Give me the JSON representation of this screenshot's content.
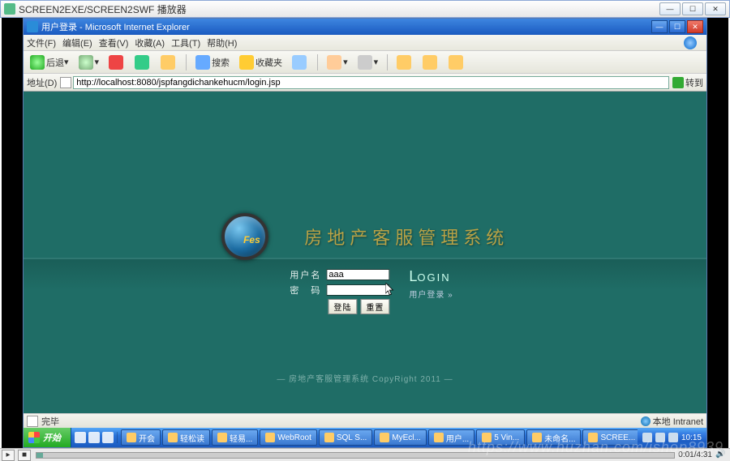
{
  "player": {
    "title": "SCREEN2EXE/SCREEN2SWF 播放器",
    "time": "0:01/4:31"
  },
  "ie": {
    "title": "用户登录 - Microsoft Internet Explorer",
    "menu": {
      "file": "文件(F)",
      "edit": "编辑(E)",
      "view": "查看(V)",
      "fav": "收藏(A)",
      "tools": "工具(T)",
      "help": "帮助(H)"
    },
    "toolbar": {
      "back": "后退",
      "search": "搜索",
      "favorites": "收藏夹"
    },
    "address_label": "地址(D)",
    "url": "http://localhost:8080/jspfangdichankehucm/login.jsp",
    "go": "转到",
    "status_done": "完毕",
    "status_zone": "本地 Intranet"
  },
  "page": {
    "system_title": "房地产客服管理系统",
    "labels": {
      "username": "用户名",
      "password": "密　码"
    },
    "username_value": "aaa",
    "password_value": "",
    "buttons": {
      "login": "登陆",
      "reset": "重置"
    },
    "heading_first": "L",
    "heading_rest": "OGIN",
    "sub": "用户登录 »",
    "footer": "— 房地产客服管理系统 CopyRight 2011 —"
  },
  "taskbar": {
    "start": "开始",
    "tasks": [
      "开会",
      "轻松读",
      "轻易...",
      "WebRoot",
      "SQL S...",
      "MyEcl...",
      "用户...",
      "5 Vin...",
      "未命名...",
      "SCREE..."
    ],
    "clock": "10:15"
  },
  "watermark": "https://www.huzhan.com/ishop8939"
}
